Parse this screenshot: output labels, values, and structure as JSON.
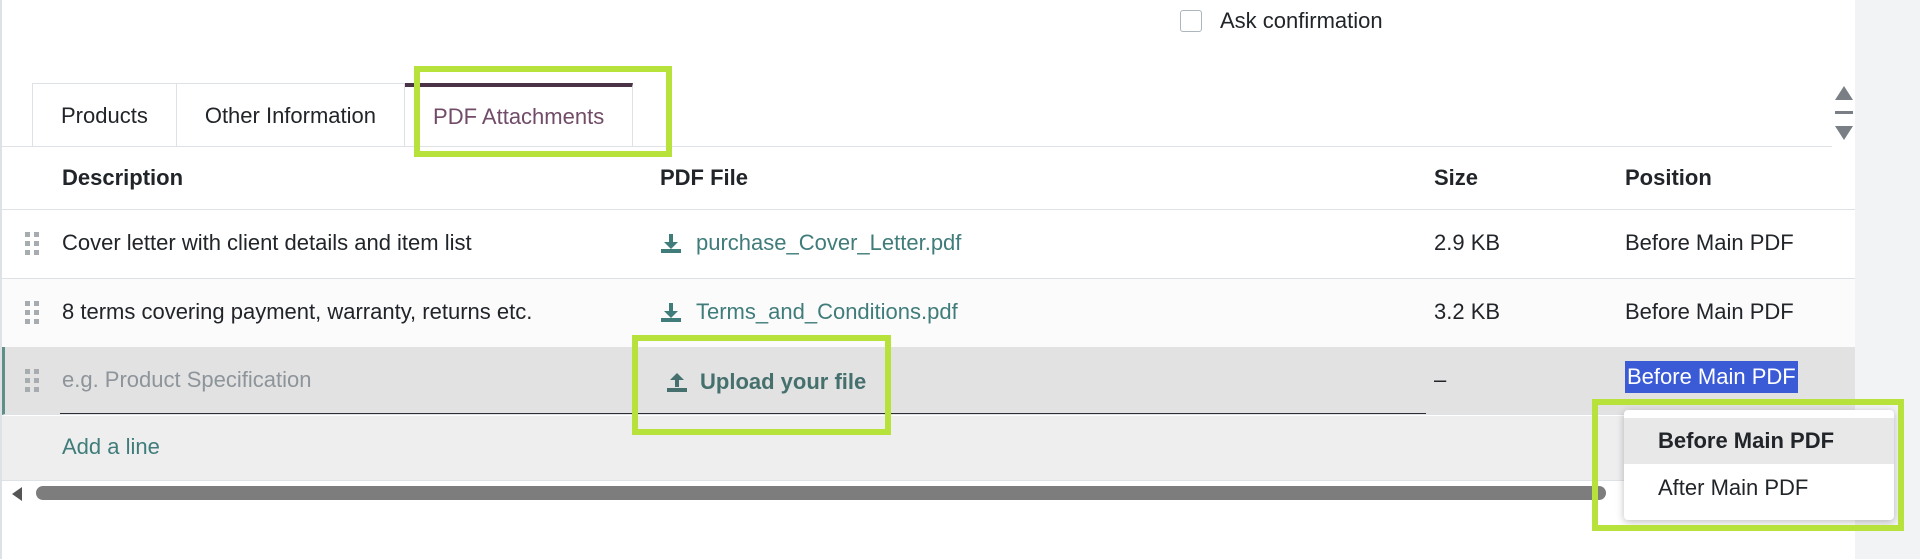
{
  "ask_confirmation": {
    "label": "Ask confirmation",
    "checked": false
  },
  "tabs": [
    {
      "label": "Products",
      "active": false
    },
    {
      "label": "Other Information",
      "active": false
    },
    {
      "label": "PDF Attachments",
      "active": true
    }
  ],
  "table": {
    "headers": {
      "description": "Description",
      "pdf_file": "PDF File",
      "size": "Size",
      "position": "Position"
    },
    "rows": [
      {
        "description": "Cover letter with client details and item list",
        "pdf_file": "purchase_Cover_Letter.pdf",
        "size": "2.9 KB",
        "position": "Before Main PDF"
      },
      {
        "description": "8 terms covering payment, warranty, returns etc.",
        "pdf_file": "Terms_and_Conditions.pdf",
        "size": "3.2 KB",
        "position": "Before Main PDF"
      }
    ],
    "editing_row": {
      "description_placeholder": "e.g. Product Specification",
      "upload_label": "Upload your file",
      "size": "–",
      "position": "Before Main PDF"
    },
    "add_line_label": "Add a line"
  },
  "position_dropdown": {
    "options": [
      "Before Main PDF",
      "After Main PDF"
    ],
    "selected": "Before Main PDF"
  },
  "colors": {
    "highlight": "#b7e23c",
    "active_tab_text": "#714b67",
    "link": "#3f7c7a",
    "selection": "#3b5bd6"
  },
  "icons": [
    "drag-handle-icon",
    "download-icon",
    "upload-icon",
    "scroll-up-icon",
    "scroll-down-icon",
    "scroll-left-icon"
  ]
}
